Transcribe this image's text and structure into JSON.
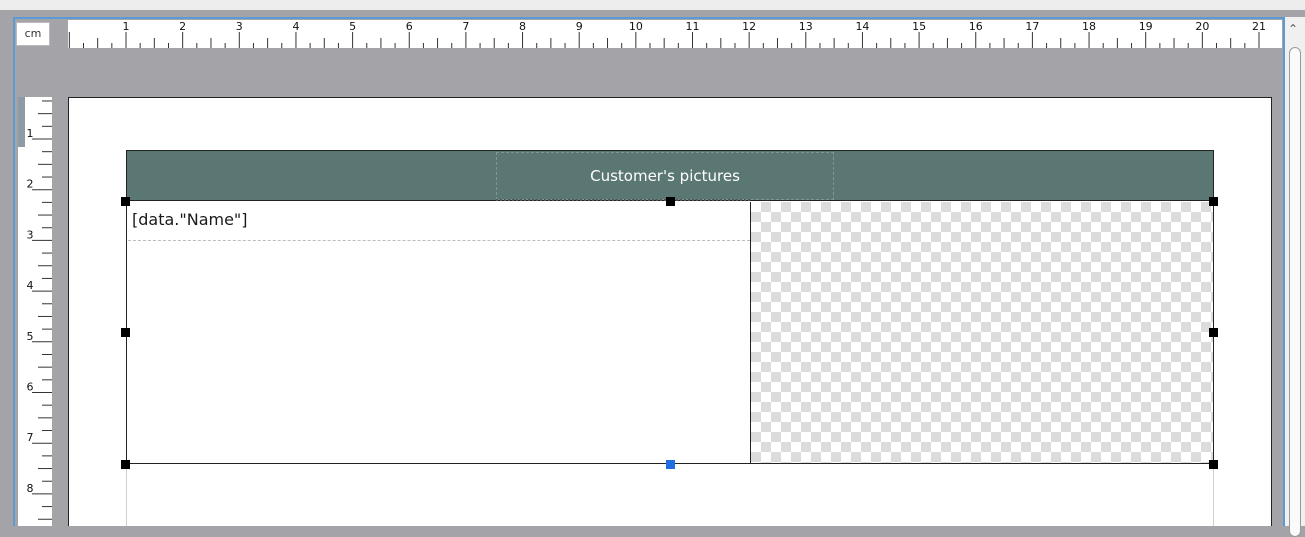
{
  "ruler": {
    "unit_label": "cm",
    "horizontal_numbers": [
      "1",
      "2",
      "3",
      "4",
      "5",
      "6",
      "7",
      "8",
      "9",
      "10",
      "11",
      "12",
      "13",
      "14",
      "15",
      "16",
      "17",
      "18",
      "19",
      "20",
      "21"
    ],
    "vertical_numbers": [
      "1",
      "2",
      "3",
      "4",
      "5",
      "6",
      "7",
      "8"
    ]
  },
  "report": {
    "header_title": "Customer's pictures",
    "name_field": "[data.\"Name\"]"
  },
  "colors": {
    "header_band": "#5b7774",
    "selection_frame": "#5b9bd5",
    "handle": "#000000",
    "handle_active": "#1f6fe0"
  },
  "icons": {
    "scroll_up": "chevron-up-icon"
  }
}
